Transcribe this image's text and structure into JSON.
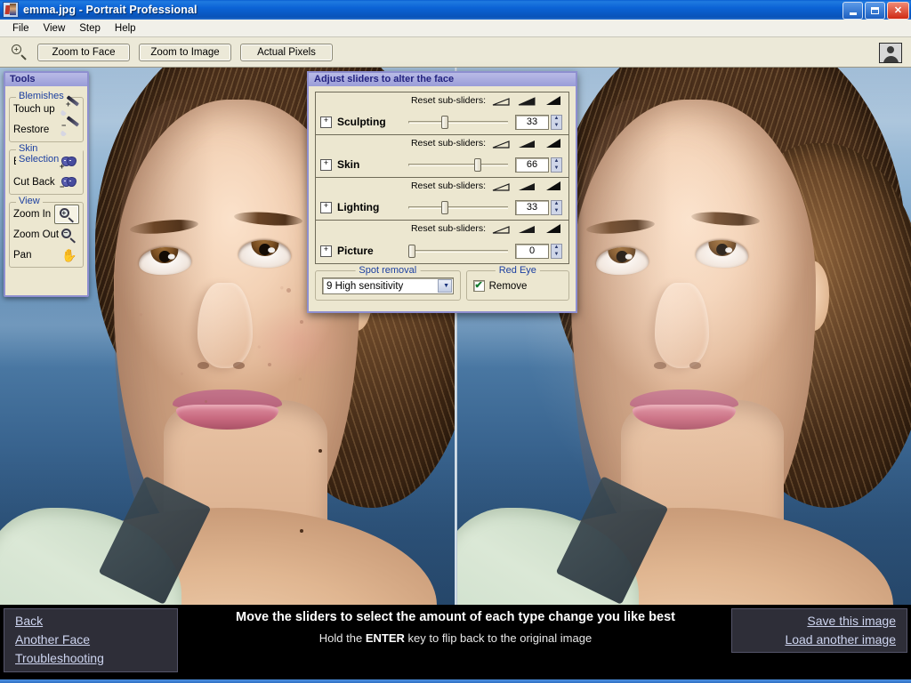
{
  "window": {
    "title": "emma.jpg - Portrait Professional",
    "app_icon": "portrait-photo-icon",
    "controls": {
      "minimize": "minimize-icon",
      "maximize": "restore-icon",
      "close": "✕"
    }
  },
  "menu": {
    "items": [
      {
        "label": "File"
      },
      {
        "label": "View"
      },
      {
        "label": "Step"
      },
      {
        "label": "Help"
      }
    ]
  },
  "toolbar": {
    "zoom_icon": "zoom-magnifier-icon",
    "buttons": [
      {
        "label": "Zoom to Face"
      },
      {
        "label": "Zoom to Image"
      },
      {
        "label": "Actual Pixels"
      }
    ],
    "face_icon": "person-thumbnail-icon"
  },
  "tools_panel": {
    "title": "Tools",
    "groups": [
      {
        "title": "Blemishes",
        "items": [
          {
            "label": "Touch up",
            "icon": "brush-plus-icon",
            "selected": false
          },
          {
            "label": "Restore",
            "icon": "brush-minus-icon",
            "selected": false
          }
        ]
      },
      {
        "title": "Skin Selection",
        "items": [
          {
            "label": "Extend",
            "icon": "masks-plus-icon",
            "selected": false
          },
          {
            "label": "Cut Back",
            "icon": "masks-minus-icon",
            "selected": false
          }
        ]
      },
      {
        "title": "View",
        "items": [
          {
            "label": "Zoom In",
            "icon": "magnifier-plus-icon",
            "selected": true
          },
          {
            "label": "Zoom Out",
            "icon": "magnifier-minus-icon",
            "selected": false
          },
          {
            "label": "Pan",
            "icon": "hand-icon",
            "selected": false
          }
        ]
      }
    ]
  },
  "slider_dialog": {
    "title": "Adjust sliders to alter the face",
    "reset_label": "Reset sub-sliders:",
    "expander_symbol": "+",
    "spin_up": "▲",
    "spin_down": "▼",
    "sliders": [
      {
        "label": "Sculpting",
        "value": "33",
        "percent": 33
      },
      {
        "label": "Skin",
        "value": "66",
        "percent": 66
      },
      {
        "label": "Lighting",
        "value": "33",
        "percent": 33
      },
      {
        "label": "Picture",
        "value": "0",
        "percent": 0
      }
    ],
    "spot_removal": {
      "title": "Spot removal",
      "selected": "9 High sensitivity",
      "arrow": "▼"
    },
    "red_eye": {
      "title": "Red Eye",
      "checkbox_label": "Remove",
      "checked": true,
      "check_glyph": "✔"
    }
  },
  "bottom_bar": {
    "left_links": [
      {
        "label": "Back"
      },
      {
        "label": "Another Face"
      },
      {
        "label": "Troubleshooting"
      }
    ],
    "right_links": [
      {
        "label": "Save this image"
      },
      {
        "label": "Load another image"
      }
    ],
    "message_line1": "Move the sliders to select the amount of each type change you like best",
    "message_line2_before": "Hold the ",
    "message_line2_key": "ENTER",
    "message_line2_after": " key to flip back to the original image"
  },
  "colors": {
    "titlebar_blue": "#0b63d6",
    "panel_beige": "#ece7d0",
    "panel_border_purple": "#8e8fd0",
    "group_label_blue": "#1b3fa0",
    "link_blue": "#cdd4ef",
    "check_green": "#137a2e",
    "water_blue": "#4a78a3",
    "hair_brown": "#5d3c22",
    "skin_tone": "#f3d2b6",
    "lip_pink": "#c8697f"
  }
}
